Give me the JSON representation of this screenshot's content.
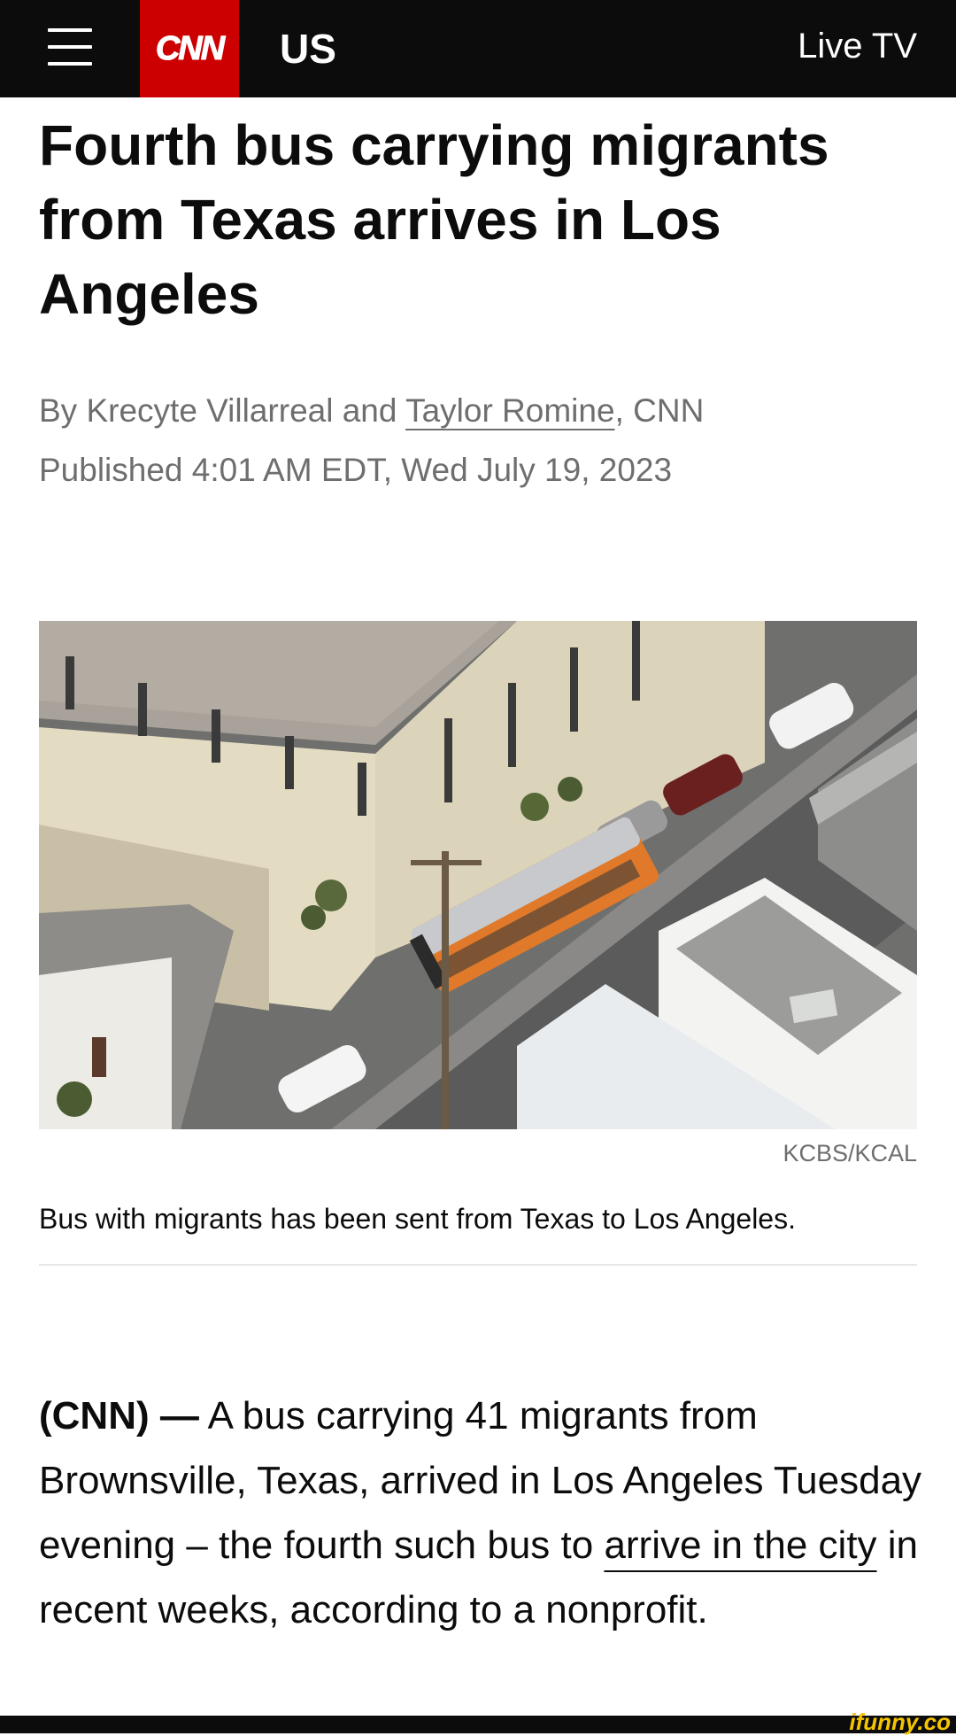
{
  "header": {
    "logo_text": "CNN",
    "section": "US",
    "live_tv": "Live TV",
    "brand_color": "#cc0000",
    "bar_color": "#0c0c0c"
  },
  "article": {
    "headline": "Fourth bus carrying migrants from Texas arrives in Los Angeles",
    "byline": {
      "prefix": "By Krecyte Villarreal and",
      "author_link": "Taylor Romine",
      "suffix": ", CNN"
    },
    "published": "Published 4:01 AM EDT, Wed July 19, 2023",
    "image": {
      "credit": "KCBS/KCAL",
      "caption": "Bus with migrants has been sent from Texas to Los Angeles."
    },
    "body": {
      "dateline": "(CNN) —",
      "text_before_link": " A bus carrying 41 migrants from Brownsville, Texas, arrived in Los Angeles Tuesday evening – the fourth such bus to ",
      "link_text": "arrive in the city",
      "text_after_link": " in recent weeks, according to a nonprofit."
    }
  },
  "watermark": "ifunny.co"
}
